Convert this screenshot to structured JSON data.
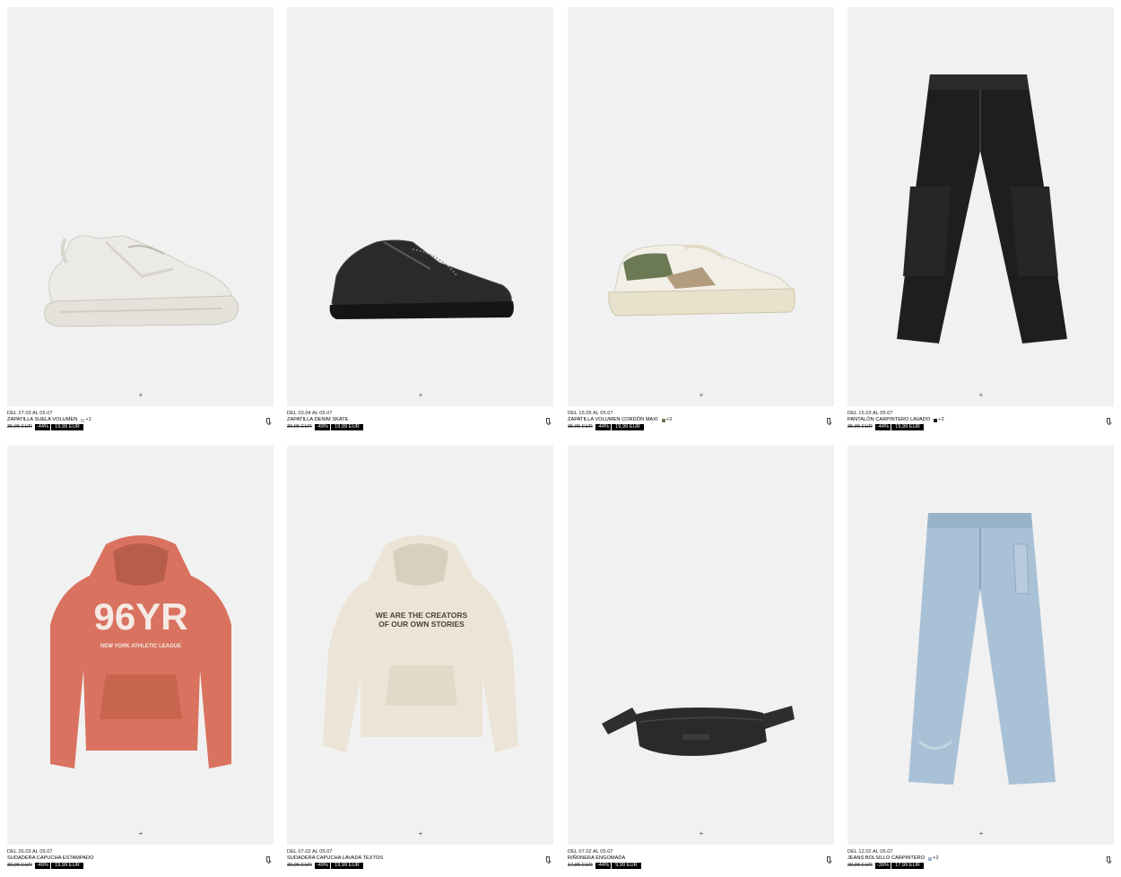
{
  "colors": {
    "image_bg": "#f1f1f1",
    "price_tag_bg": "#000000",
    "price_tag_text": "#ffffff"
  },
  "products": [
    {
      "date": "DEL 27.03 AL 05.07",
      "name": "ZAPATILLA SUELA VOLUMEN",
      "swatch": "#e8e6df",
      "more": "+1",
      "old_price": "35,95 EUR",
      "discount": "-44%",
      "new_price": "19,99 EUR",
      "image": "chunky-white-sneaker"
    },
    {
      "date": "DEL 03.04 AL 05.07",
      "name": "ZAPATILLA DENIM SKATE",
      "swatch": "",
      "more": "",
      "old_price": "39,95 EUR",
      "discount": "-49%",
      "new_price": "19,99 EUR",
      "image": "black-denim-sneaker"
    },
    {
      "date": "DEL 15.05 AL 05.07",
      "name": "ZAPATILLA VOLUMEN CORDÓN MAXI",
      "swatch": "#6b7a55",
      "more": "+3",
      "old_price": "35,95 EUR",
      "discount": "-44%",
      "new_price": "19,99 EUR",
      "image": "green-cream-sneaker"
    },
    {
      "date": "DEL 15.03 AL 05.07",
      "name": "PANTALÓN CARPINTERO LAVADO",
      "swatch": "#1c1c1c",
      "more": "+2",
      "old_price": "35,95 EUR",
      "discount": "-44%",
      "new_price": "19,99 EUR",
      "image": "black-carpenter-pants"
    },
    {
      "date": "DEL 26.03 AL 05.07",
      "name": "SUDADERA CAPUCHA ESTAMPADO",
      "swatch": "",
      "more": "",
      "old_price": "39,95 EUR",
      "discount": "-49%",
      "new_price": "19,99 EUR",
      "image": "orange-hoodie",
      "print_big": "96YR",
      "print_small": "NEW YORK ATHLETIC LEAGUE"
    },
    {
      "date": "DEL 07.02 AL 05.07",
      "name": "SUDADERA CAPUCHA LAVADA TEXTOS",
      "swatch": "",
      "more": "",
      "old_price": "39,95 EUR",
      "discount": "-49%",
      "new_price": "19,99 EUR",
      "image": "cream-hoodie",
      "print_line1": "WE ARE THE CREATORS",
      "print_line2": "OF OUR OWN STORIES"
    },
    {
      "date": "DEL 07.02 AL 05.07",
      "name": "RIÑONERA ENGOMADA",
      "swatch": "",
      "more": "",
      "old_price": "17,95 EUR",
      "discount": "-44%",
      "new_price": "9,99 EUR",
      "image": "black-belt-bag"
    },
    {
      "date": "DEL 12.02 AL 05.07",
      "name": "JEANS BOLSILLO CARPINTERO",
      "swatch": "#9fb6cc",
      "more": "+2",
      "old_price": "29,95 EUR",
      "discount": "-39%",
      "new_price": "17,99 EUR",
      "image": "light-blue-jeans"
    }
  ],
  "add_symbol": "+"
}
